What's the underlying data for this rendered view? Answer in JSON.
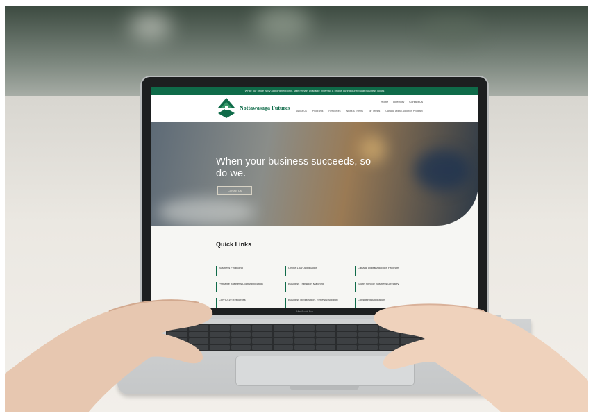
{
  "site": {
    "notice": "While our office is by appointment only, staff remain available by email & phone during our regular business hours",
    "utility_links": [
      "Home",
      "Directory",
      "Contact Us"
    ],
    "logo_text": "Nottawasaga Futures",
    "nav_items": [
      "About Us",
      "Programs",
      "Resources",
      "News & Events",
      "NF Temps",
      "Canada Digital Adoption Program"
    ],
    "hero": {
      "headline": "When your business succeeds, so do we.",
      "cta": "Contact Us"
    },
    "quick_links": {
      "title": "Quick Links",
      "items": [
        "Business Financing",
        "Online Loan Application",
        "Canada Digital Adoption Program",
        "Printable Business Loan Application",
        "Business Transition Matching",
        "South Simcoe Business Directory",
        "COVID-19 Resources",
        "Business Registration, Renewal Support",
        "Consulting Application"
      ]
    },
    "colors": {
      "brand_green": "#0f6b49",
      "page_bg": "#f6f6f3"
    }
  },
  "laptop": {
    "brand_label": "MacBook Pro"
  }
}
